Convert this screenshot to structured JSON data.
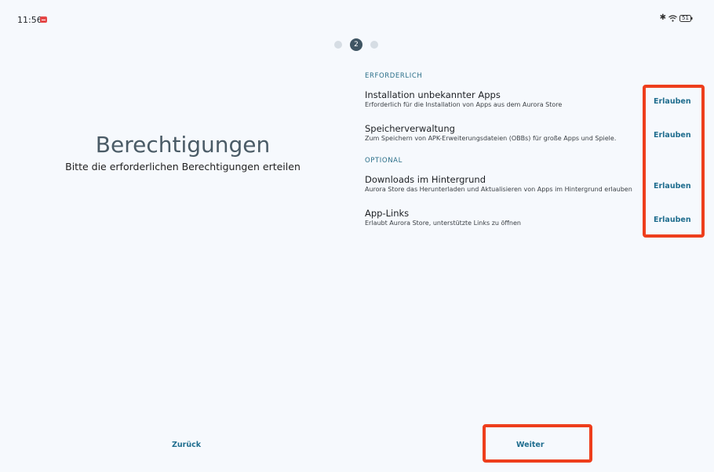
{
  "status_bar": {
    "time": "11:56",
    "battery_level": "51",
    "icons": [
      "notification-icon",
      "bluetooth-icon",
      "wifi-icon",
      "battery-icon"
    ]
  },
  "stepper": {
    "current_step": "2"
  },
  "header": {
    "title": "Berechtigungen",
    "subtitle": "Bitte die erforderlichen Berechtigungen erteilen"
  },
  "sections": {
    "required_label": "ERFORDERLICH",
    "optional_label": "OPTIONAL"
  },
  "permissions": [
    {
      "title": "Installation unbekannter Apps",
      "description": "Erforderlich für die Installation von Apps aus dem Aurora Store",
      "action": "Erlauben"
    },
    {
      "title": "Speicherverwaltung",
      "description": "Zum Speichern von APK-Erweiterungsdateien (OBBs) für große Apps und Spiele.",
      "action": "Erlauben"
    },
    {
      "title": "Downloads im Hintergrund",
      "description": "Aurora Store das Herunterladen und Aktualisieren von Apps im Hintergrund erlauben",
      "action": "Erlauben"
    },
    {
      "title": "App-Links",
      "description": "Erlaubt Aurora Store, unterstützte Links zu öffnen",
      "action": "Erlauben"
    }
  ],
  "footer": {
    "back_label": "Zurück",
    "next_label": "Weiter"
  },
  "colors": {
    "background": "#f6f9fd",
    "accent": "#1f6d8e",
    "highlight": "#ee3e1c"
  }
}
